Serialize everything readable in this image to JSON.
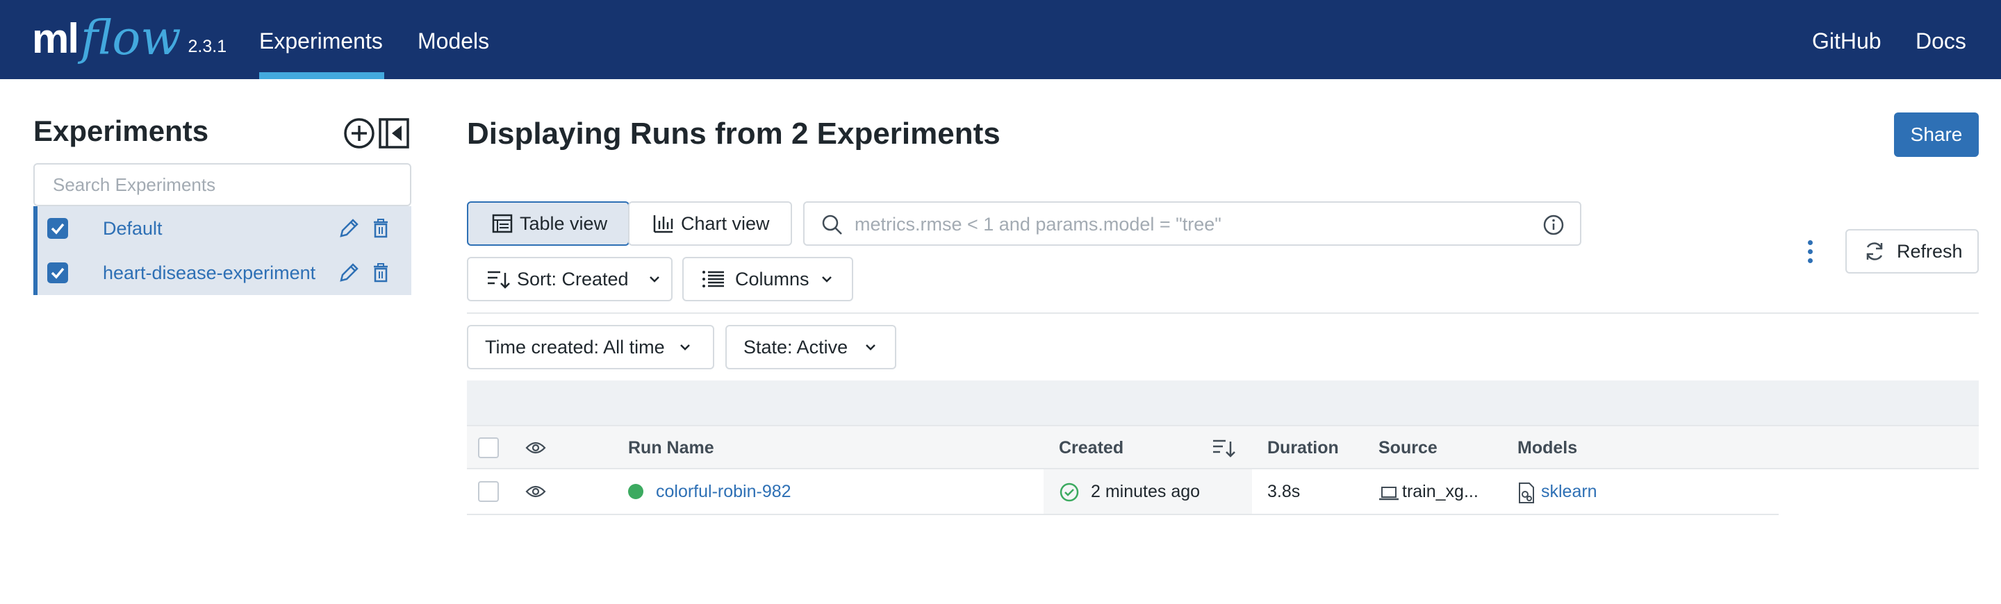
{
  "header": {
    "logo_ml": "ml",
    "logo_flow": "flow",
    "version": "2.3.1",
    "nav": [
      "Experiments",
      "Models"
    ],
    "nav_active": "Experiments",
    "right_links": [
      "GitHub",
      "Docs"
    ],
    "colors": {
      "background": "#16346f",
      "accent": "#43a9de"
    }
  },
  "sidebar": {
    "title": "Experiments",
    "add_icon": "plus-circle-icon",
    "collapse_icon": "collapse-sidebar-icon",
    "search": {
      "placeholder": "Search Experiments",
      "value": ""
    },
    "experiments": [
      {
        "label": "Default",
        "checked": true
      },
      {
        "label": "heart-disease-experiment",
        "checked": true
      }
    ]
  },
  "main": {
    "title": "Displaying Runs from 2 Experiments",
    "share_label": "Share",
    "view_toggle": {
      "table_label": "Table view",
      "chart_label": "Chart view",
      "active": "Table view"
    },
    "filter": {
      "placeholder": "metrics.rmse < 1 and params.model = \"tree\"",
      "value": ""
    },
    "sort_label": "Sort: Created",
    "columns_label": "Columns",
    "time_filter_label": "Time created: All time",
    "state_filter_label": "State: Active",
    "refresh_label": "Refresh"
  },
  "table": {
    "columns": [
      "Run Name",
      "Created",
      "Duration",
      "Source",
      "Models"
    ],
    "rows": [
      {
        "run_name": "colorful-robin-982",
        "status": "finished",
        "created": "2 minutes ago",
        "duration": "3.8s",
        "source": "train_xg...",
        "model": "sklearn"
      }
    ]
  },
  "colors": {
    "primary": "#2e70b5",
    "success": "#3caa60",
    "selected_bg": "#dfe6ef"
  }
}
